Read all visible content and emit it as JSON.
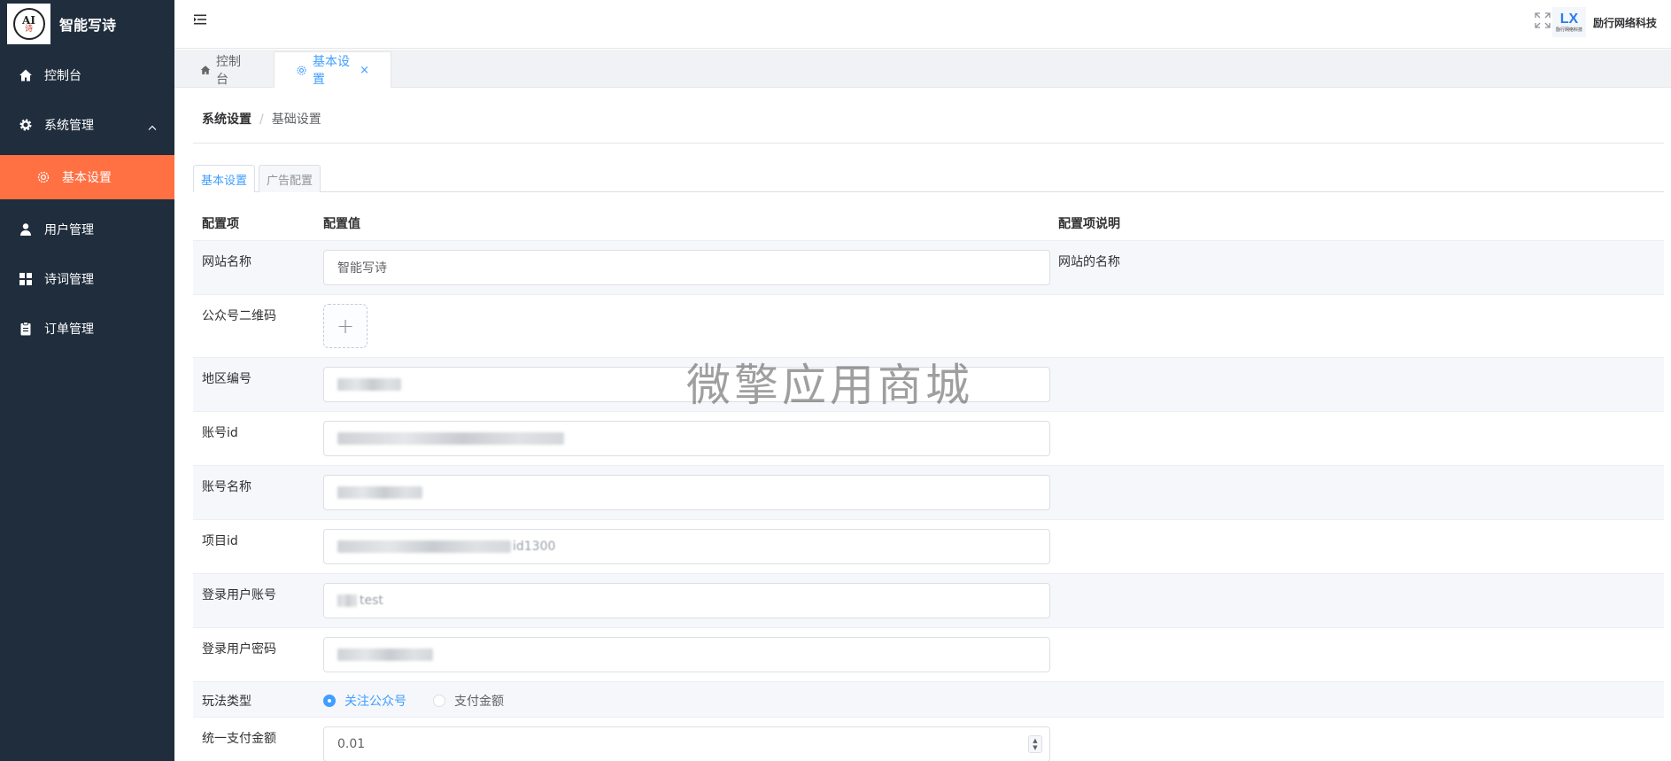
{
  "app": {
    "title": "智能写诗",
    "logo_text_top": "AI",
    "logo_text_bottom": "诗"
  },
  "sidebar": {
    "items": [
      {
        "label": "控制台",
        "icon": "home-icon"
      },
      {
        "label": "系统管理",
        "icon": "gear-icon",
        "expanded": true
      },
      {
        "label": "基本设置",
        "icon": "gear-outline-icon",
        "active": true
      },
      {
        "label": "用户管理",
        "icon": "user-icon"
      },
      {
        "label": "诗词管理",
        "icon": "grid-icon"
      },
      {
        "label": "订单管理",
        "icon": "clipboard-icon"
      }
    ]
  },
  "header": {
    "company_logo": "LX",
    "company_logo_sub": "励行网络科技",
    "company_name": "励行网络科技"
  },
  "tabs": [
    {
      "label": "控制台",
      "icon": "home-icon"
    },
    {
      "label": "基本设置",
      "icon": "gear-outline-icon",
      "active": true,
      "close": "×"
    }
  ],
  "breadcrumb": {
    "level1": "系统设置",
    "separator": "/",
    "level2": "基础设置"
  },
  "subtabs": [
    "基本设置",
    "广告配置"
  ],
  "table": {
    "headers": [
      "配置项",
      "配置值",
      "配置项说明"
    ],
    "rows": {
      "site_name": {
        "label": "网站名称",
        "value": "智能写诗",
        "desc": "网站的名称"
      },
      "qrcode": {
        "label": "公众号二维码",
        "upload_icon": "+"
      },
      "region": {
        "label": "地区编号"
      },
      "account_id": {
        "label": "账号id"
      },
      "account_name": {
        "label": "账号名称"
      },
      "project_id": {
        "label": "项目id",
        "value_tail": "id1300"
      },
      "login_user": {
        "label": "登录用户账号",
        "value_tail": "test"
      },
      "login_pwd": {
        "label": "登录用户密码"
      },
      "play_type": {
        "label": "玩法类型",
        "options": [
          "关注公众号",
          "支付金额"
        ],
        "selected": "关注公众号"
      },
      "pay_amount": {
        "label": "统一支付金额",
        "value": "0.01",
        "spinner_up": "▲",
        "spinner_down": "▼"
      }
    }
  },
  "watermark": "微擎应用商城",
  "colors": {
    "sidebar_bg": "#1f2d3d",
    "active_menu": "#ff7043",
    "primary": "#409eff"
  }
}
